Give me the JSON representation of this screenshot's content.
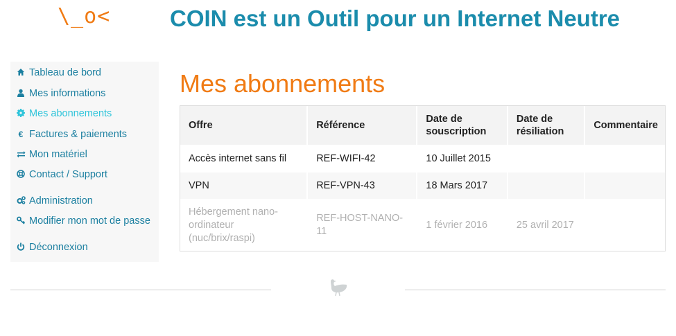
{
  "header": {
    "logo_text": "\\_o<",
    "site_title": "COIN est un Outil pour un Internet Neutre"
  },
  "sidebar": {
    "items": [
      {
        "label": "Tableau de bord",
        "icon": "home-icon"
      },
      {
        "label": "Mes informations",
        "icon": "user-icon"
      },
      {
        "label": "Mes abonnements",
        "icon": "gear-icon",
        "active": true
      },
      {
        "label": "Factures & paiements",
        "icon": "euro-icon"
      },
      {
        "label": "Mon matériel",
        "icon": "exchange-icon"
      },
      {
        "label": "Contact / Support",
        "icon": "lifebuoy-icon"
      },
      {
        "label": "Administration",
        "icon": "gears-icon"
      },
      {
        "label": "Modifier mon mot de passe",
        "icon": "key-icon"
      },
      {
        "label": "Déconnexion",
        "icon": "power-icon"
      }
    ]
  },
  "main": {
    "title": "Mes abonnements",
    "table": {
      "headers": [
        "Offre",
        "Référence",
        "Date de souscription",
        "Date de résiliation",
        "Commentaire"
      ],
      "rows": [
        [
          "Accès internet sans fil",
          "REF-WIFI-42",
          "10 Juillet 2015",
          "",
          ""
        ],
        [
          "VPN",
          "REF-VPN-43",
          "18 Mars 2017",
          "",
          ""
        ],
        [
          "Hébergement nano-ordinateur (nuc/brix/raspi)",
          "REF-HOST-NANO-11",
          "1 février 2016",
          "25 avril 2017",
          ""
        ]
      ]
    }
  },
  "colors": {
    "accent_orange": "#f07b14",
    "title_blue": "#1b8cac",
    "link_blue": "#1b7fa0",
    "active_cyan": "#2ec4da"
  }
}
